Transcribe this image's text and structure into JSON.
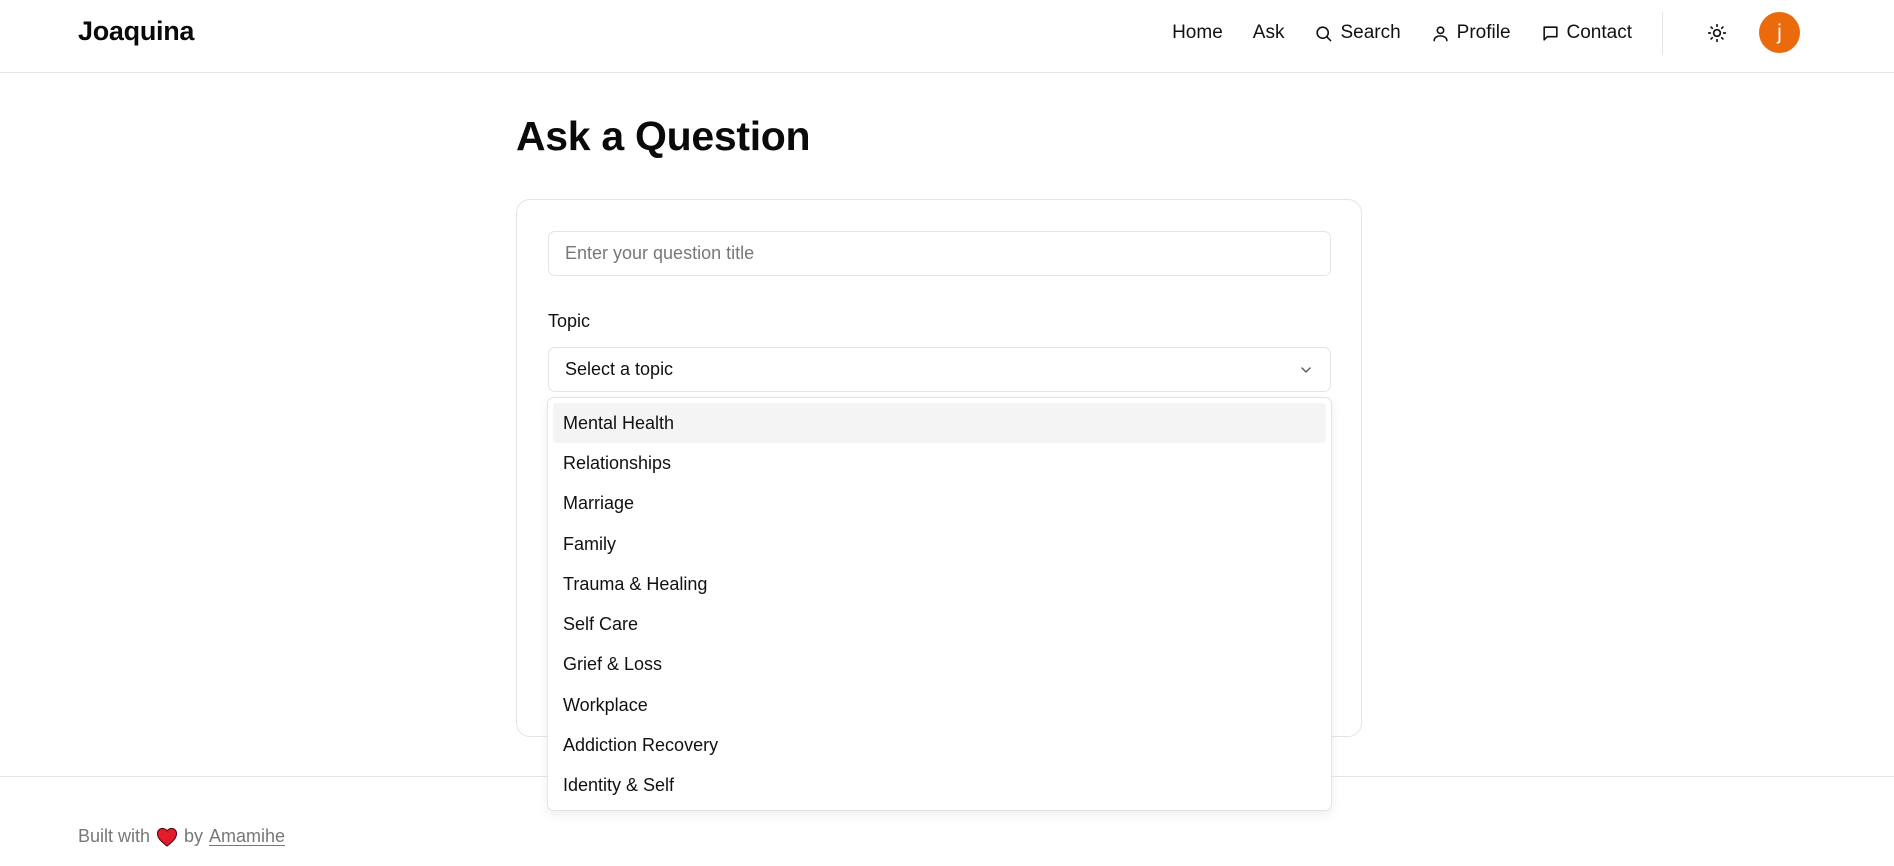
{
  "header": {
    "brand": "Joaquina",
    "nav": [
      {
        "label": "Home",
        "icon": null
      },
      {
        "label": "Ask",
        "icon": null
      },
      {
        "label": "Search",
        "icon": "search-icon"
      },
      {
        "label": "Profile",
        "icon": "user-icon"
      },
      {
        "label": "Contact",
        "icon": "message-square-icon"
      }
    ],
    "theme_icon": "sun-icon",
    "avatar_initial": "j",
    "avatar_color": "#ea6a0c"
  },
  "main": {
    "page_title": "Ask a Question",
    "title_input": {
      "placeholder": "Enter your question title",
      "value": ""
    },
    "topic_label": "Topic",
    "topic_select": {
      "selected": "Select a topic",
      "icon": "chevron-down-icon"
    },
    "topic_options": [
      "Mental Health",
      "Relationships",
      "Marriage",
      "Family",
      "Trauma & Healing",
      "Self Care",
      "Grief & Loss",
      "Workplace",
      "Addiction Recovery",
      "Identity & Self"
    ],
    "highlighted_option": "Mental Health"
  },
  "footer": {
    "built_with": "Built with",
    "heart_icon": "heart-icon",
    "heart_color": "#e11d2b",
    "by": "by",
    "author": "Amamihe"
  }
}
